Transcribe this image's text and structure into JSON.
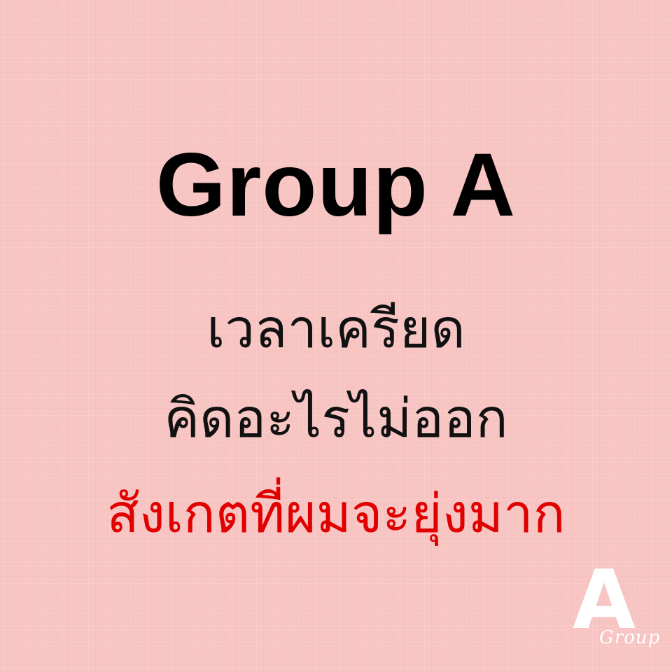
{
  "title": "Group A",
  "lines": [
    {
      "text": "เวลาเครียด",
      "color": "#111111"
    },
    {
      "text": "คิดอะไรไม่ออก",
      "color": "#111111"
    },
    {
      "text": "สังเกตที่ผมจะยุ่งมาก",
      "color": "#e00000"
    }
  ],
  "logo": {
    "letter": "A",
    "word": "Group",
    "color": "#ffffff"
  },
  "colors": {
    "background": "#f7c4c2",
    "title": "#000000"
  }
}
